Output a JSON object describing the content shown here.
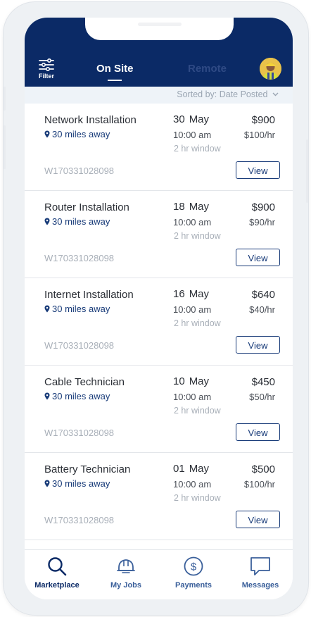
{
  "header": {
    "filter_label": "Filter",
    "tabs": [
      {
        "label": "On Site",
        "active": true
      },
      {
        "label": "Remote",
        "active": false
      }
    ],
    "avatar_icon": "user-avatar"
  },
  "sort": {
    "label": "Sorted by: Date Posted",
    "icon": "chevron-down-icon"
  },
  "jobs": [
    {
      "title": "Network Installation",
      "distance": "30 miles away",
      "id": "W170331028098",
      "day": "30",
      "month": "May",
      "time": "10:00 am",
      "window": "2 hr window",
      "price": "$900",
      "rate": "$100/hr",
      "button": "View"
    },
    {
      "title": "Router Installation",
      "distance": "30 miles away",
      "id": "W170331028098",
      "day": "18",
      "month": "May",
      "time": "10:00 am",
      "window": "2 hr window",
      "price": "$900",
      "rate": "$90/hr",
      "button": "View"
    },
    {
      "title": "Internet Installation",
      "distance": "30 miles away",
      "id": "W170331028098",
      "day": "16",
      "month": "May",
      "time": "10:00 am",
      "window": "2 hr window",
      "price": "$640",
      "rate": "$40/hr",
      "button": "View"
    },
    {
      "title": "Cable Technician",
      "distance": "30 miles away",
      "id": "W170331028098",
      "day": "10",
      "month": "May",
      "time": "10:00 am",
      "window": "2 hr window",
      "price": "$450",
      "rate": "$50/hr",
      "button": "View"
    },
    {
      "title": "Battery Technician",
      "distance": "30 miles away",
      "id": "W170331028098",
      "day": "01",
      "month": "May",
      "time": "10:00 am",
      "window": "2 hr window",
      "price": "$500",
      "rate": "$100/hr",
      "button": "View"
    }
  ],
  "nav": [
    {
      "label": "Marketplace",
      "icon": "search-icon",
      "active": true
    },
    {
      "label": "My Jobs",
      "icon": "hard-hat-icon",
      "active": false
    },
    {
      "label": "Payments",
      "icon": "dollar-icon",
      "active": false
    },
    {
      "label": "Messages",
      "icon": "chat-icon",
      "active": false
    }
  ],
  "colors": {
    "primary": "#0b2a66",
    "accent": "#173a78",
    "muted": "#a8afb8"
  }
}
